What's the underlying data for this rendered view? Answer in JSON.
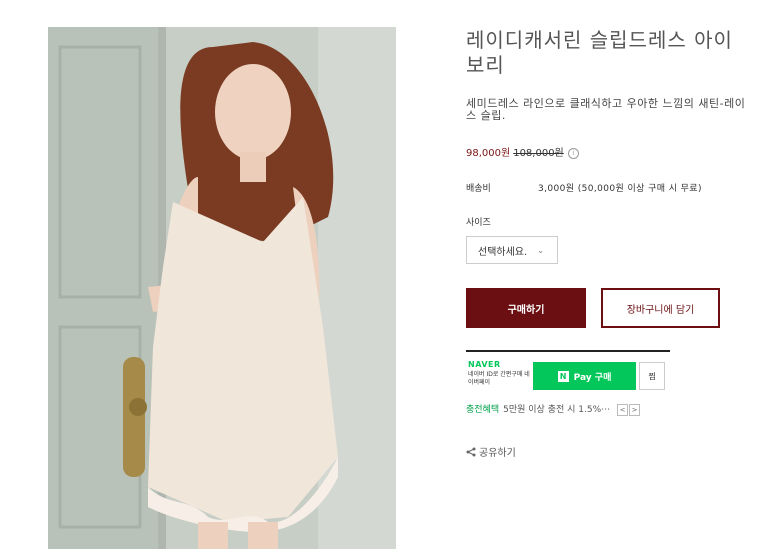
{
  "product": {
    "title": "레이디캐서린 슬립드레스 아이보리",
    "summary": "세미드레스 라인으로 클래식하고 우아한 느낌의 새틴-레이스 슬립.",
    "price_current": "98,000원",
    "price_original": "108,000원",
    "info_icon": "i"
  },
  "shipping": {
    "label": "배송비",
    "value": "3,000원 (50,000원 이상 구매 시 무료)"
  },
  "size": {
    "label": "사이즈",
    "selected": "선택하세요."
  },
  "actions": {
    "buy_label": "구매하기",
    "cart_label": "장바구니에 담기"
  },
  "naver": {
    "logo": "NAVER",
    "sub": "네이버 ID로 간편구매 네이버페이",
    "pay_n": "N",
    "pay_label": "Pay 구매",
    "zzim_label": "찜",
    "point_tag": "충전혜택",
    "point_text": "5만원 이상 충전 시 1.5%⋯",
    "prev_arrow": "<",
    "next_arrow": ">"
  },
  "share": {
    "label": "공유하기"
  },
  "colors": {
    "accent": "#6b0f13",
    "naver_green": "#03c75a"
  }
}
